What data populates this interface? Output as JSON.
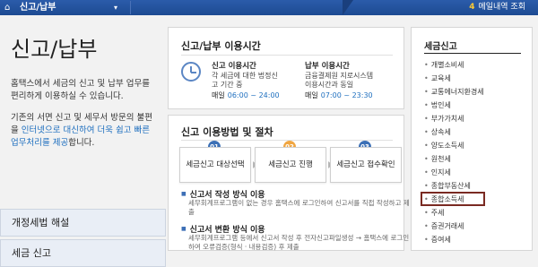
{
  "topbar": {
    "home_icon": "home-icon",
    "title": "신고/납부",
    "caret": "▾",
    "cart_count": "4",
    "right_label": "메일내역 조회"
  },
  "left": {
    "title": "신고/납부",
    "intro": "홈택스에서 세금의 신고 및 납부 업무를 편리하게 이용하실 수 있습니다.",
    "intro2_prefix": "기존의 서면 신고 및 세무서 방문의 불편을 ",
    "intro2_link": "인터넷으로 대신하여 더욱 쉽고 빠른 업무처리를 제공",
    "intro2_suffix": "합니다.",
    "btn1": "개정세법 해설",
    "btn2": "세금 신고"
  },
  "hours": {
    "title": "신고/납부 이용시간",
    "file_title": "신고 이용시간",
    "file_desc": "각 세금에 대한 법정신고 기간 중",
    "file_daily": "매일",
    "file_time": "06:00 ~ 24:00",
    "pay_title": "납부 이용시간",
    "pay_desc": "금융결제원 지로시스템 이용시간과 동일",
    "pay_daily": "매일",
    "pay_time": "07:00 ~ 23:30"
  },
  "method": {
    "title": "신고 이용방법 및 절차",
    "steps": [
      {
        "num": "01",
        "label": "세금신고 대상선택",
        "color": "#3c70b6"
      },
      {
        "num": "02",
        "label": "세금신고 진행",
        "color": "#f0a642"
      },
      {
        "num": "03",
        "label": "세금신고 접수확인",
        "color": "#3c70b6"
      }
    ],
    "ways": [
      {
        "title": "신고서 작성 방식 이용",
        "desc": "세무회계프로그램이 없는 경우 홈택스에 로그인하여 신고서를 직접 작성하고 제출"
      },
      {
        "title": "신고서 변환 방식 이용",
        "desc": "세무회계프로그램 등에서 신고서 작성 후 전자신고파일생성 → 홈택스에 로그인하여 오류검증(형식 · 내용검증) 후 제출"
      }
    ]
  },
  "right": {
    "title": "세금신고",
    "items": [
      "개별소비세",
      "교육세",
      "교통에너지환경세",
      "법인세",
      "부가가치세",
      "상속세",
      "양도소득세",
      "원천세",
      "인지세",
      "종합부동산세",
      "종합소득세",
      "주세",
      "증권거래세",
      "증여세"
    ],
    "highlighted": "종합소득세"
  }
}
